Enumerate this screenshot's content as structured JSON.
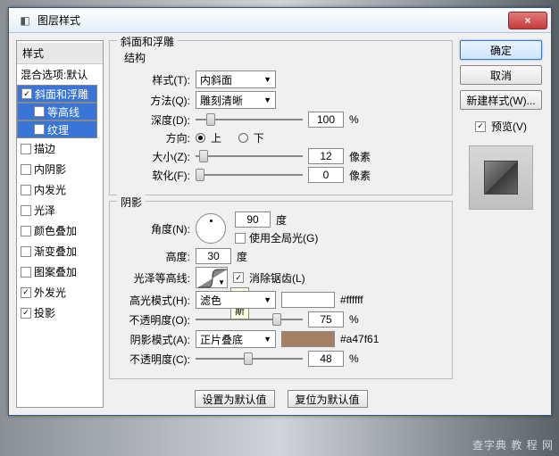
{
  "window": {
    "title": "图层样式",
    "close": "×"
  },
  "left": {
    "header": "样式",
    "blend": "混合选项:默认",
    "items": [
      {
        "label": "斜面和浮雕",
        "chk": true,
        "sel": true
      },
      {
        "label": "等高线",
        "chk": false,
        "sub": true,
        "sel": true
      },
      {
        "label": "纹理",
        "chk": false,
        "sub": true,
        "sel": true
      },
      {
        "label": "描边",
        "chk": false
      },
      {
        "label": "内阴影",
        "chk": false
      },
      {
        "label": "内发光",
        "chk": false
      },
      {
        "label": "光泽",
        "chk": false
      },
      {
        "label": "颜色叠加",
        "chk": false
      },
      {
        "label": "渐变叠加",
        "chk": false
      },
      {
        "label": "图案叠加",
        "chk": false
      },
      {
        "label": "外发光",
        "chk": true
      },
      {
        "label": "投影",
        "chk": true
      }
    ]
  },
  "bevel": {
    "group": "斜面和浮雕",
    "struct": "结构",
    "style_lbl": "样式(T):",
    "style_val": "内斜面",
    "tech_lbl": "方法(Q):",
    "tech_val": "雕刻清晰",
    "depth_lbl": "深度(D):",
    "depth_val": "100",
    "depth_unit": "%",
    "dir_lbl": "方向:",
    "dir_up": "上",
    "dir_down": "下",
    "size_lbl": "大小(Z):",
    "size_val": "12",
    "size_unit": "像素",
    "soft_lbl": "软化(F):",
    "soft_val": "0",
    "soft_unit": "像素"
  },
  "shade": {
    "group": "阴影",
    "angle_lbl": "角度(N):",
    "angle_val": "90",
    "angle_unit": "度",
    "global": "使用全局光(G)",
    "alt_lbl": "高度:",
    "alt_val": "30",
    "alt_unit": "度",
    "gloss_lbl": "光泽等高线:",
    "anti": "消除锯齿(L)",
    "tooltip": "高斯",
    "hi_mode_lbl": "高光模式(H):",
    "hi_mode_val": "滤色",
    "hi_color": "#ffffff",
    "hi_hex": "#ffffff",
    "hi_op_lbl": "不透明度(O):",
    "hi_op_val": "75",
    "hi_op_unit": "%",
    "sh_mode_lbl": "阴影模式(A):",
    "sh_mode_val": "正片叠底",
    "sh_color": "#a47f61",
    "sh_hex": "#a47f61",
    "sh_op_lbl": "不透明度(C):",
    "sh_op_val": "48",
    "sh_op_unit": "%"
  },
  "buttons": {
    "default": "设置为默认值",
    "reset": "复位为默认值"
  },
  "right": {
    "ok": "确定",
    "cancel": "取消",
    "newstyle": "新建样式(W)...",
    "preview": "预览(V)"
  },
  "watermark": "查字典  教 程 网"
}
